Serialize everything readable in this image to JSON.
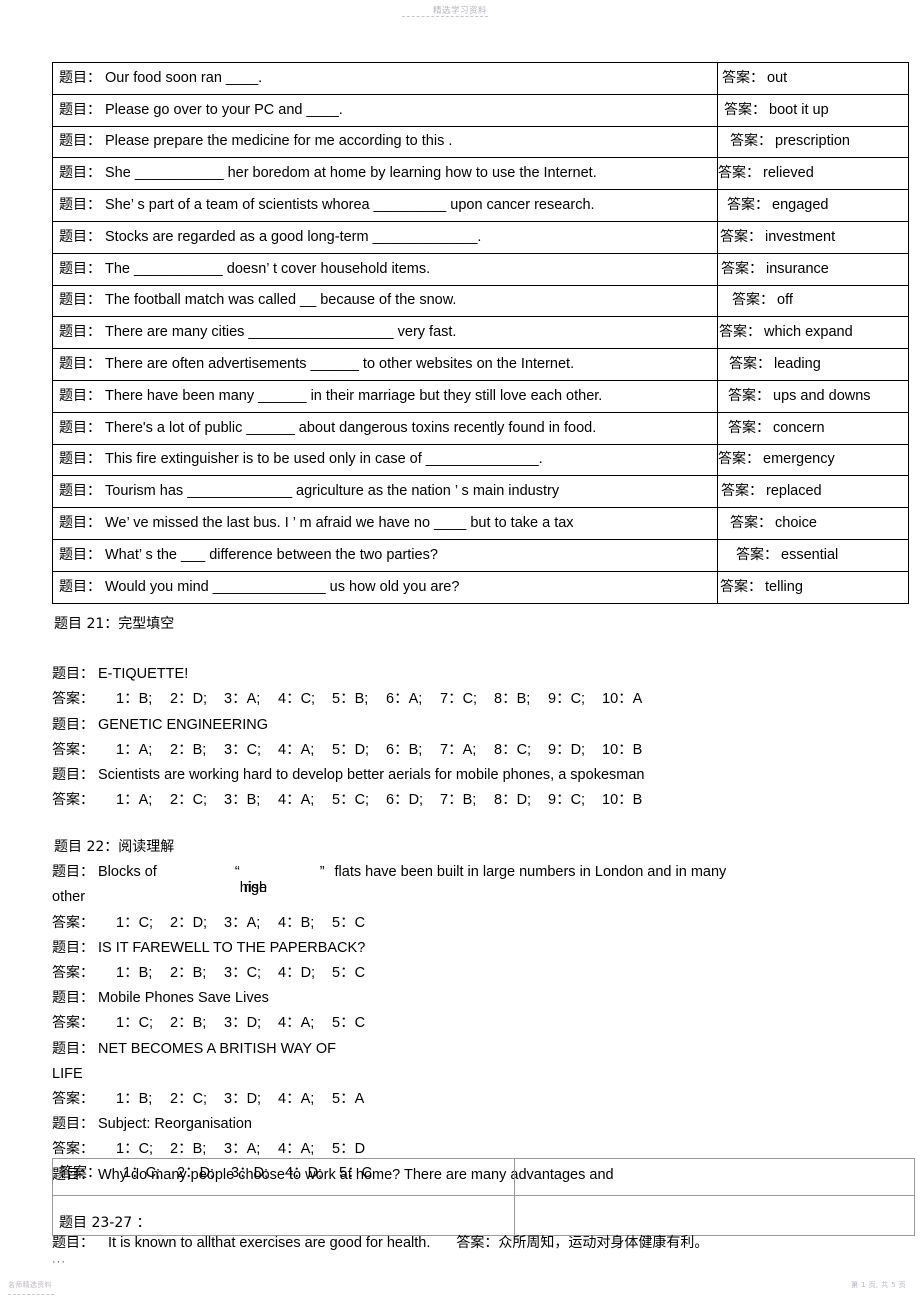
{
  "header": {
    "watermark": "精选学习资料"
  },
  "footer": {
    "left_mark": "名师精选资料",
    "page_number": "第 1 页, 共 5 页"
  },
  "labels": {
    "question": "题目：",
    "answer": "答案：",
    "question_no_colon": "题目"
  },
  "main_table": {
    "rows": [
      {
        "question": "Our food soon ran ____.",
        "answer": "out"
      },
      {
        "question": "Please go over to your PC and ____.",
        "answer": "boot it up"
      },
      {
        "question": "Please prepare the medicine for me according to this              .",
        "answer": "prescription"
      },
      {
        "question": "She ___________ her boredom at home by learning how to use the Internet.",
        "answer": "relieved"
      },
      {
        "question": "She’  s part of a team of scientists whorea _________ upon cancer research.",
        "answer": "engaged"
      },
      {
        "question": "Stocks are regarded as a good long-term _____________.",
        "answer": "investment"
      },
      {
        "question": "The ___________ doesn’  t cover household items.",
        "answer": "insurance"
      },
      {
        "question": "The football match was called __ because of the snow.",
        "answer": "off"
      },
      {
        "question": "There are many cities __________________ very fast.",
        "answer": "which expand"
      },
      {
        "question": "There are often advertisements ______ to other websites on the Internet.",
        "answer": "leading"
      },
      {
        "question": "There have been many ______ in their marriage but they still love each other.",
        "answer": "ups and downs"
      },
      {
        "question": "There's a lot of public ______ about dangerous toxins recently found in food.",
        "answer": "concern"
      },
      {
        "question": "This fire extinguisher is to be used only in case of ______________.",
        "answer": "emergency"
      },
      {
        "question": "Tourism has _____________ agriculture as the nation          ’ s main industry",
        "answer": "replaced"
      },
      {
        "question": "We’  ve missed the last bus. I          ’ m afraid we have no ____ but to take a tax",
        "answer": "choice"
      },
      {
        "question": "What’  s the ___ difference between the two parties?",
        "answer": "essential"
      },
      {
        "question": "Would you mind ______________ us how old you are?",
        "answer": "telling"
      }
    ]
  },
  "section21": {
    "heading": "题目 21：完型填空",
    "entries": [
      {
        "title": "E-TIQUETTE!",
        "answers": [
          "1：B;",
          "2：D;",
          "3：A;",
          "4：C;",
          "5：B;",
          "6：A;",
          "7：C;",
          "8：B;",
          "9：C;",
          "10：A"
        ]
      },
      {
        "title": "GENETIC ENGINEERING",
        "answers": [
          "1：A;",
          "2：B;",
          "3：C;",
          "4：A;",
          "5：D;",
          "6：B;",
          "7：A;",
          "8：C;",
          "9：D;",
          "10：B"
        ]
      },
      {
        "title": "Scientists are working hard to develop better aerials for mobile phones, a spokesman",
        "answers": [
          "1：A;",
          "2：C;",
          "3：B;",
          "4：A;",
          "5：C;",
          "6：D;",
          "7：B;",
          "8：D;",
          "9：C;",
          "10：B"
        ]
      }
    ]
  },
  "section22": {
    "heading": "题目 22：阅读理解",
    "first_entry": {
      "prefix": "Blocks of",
      "quote_open": "“",
      "overlap_a": "high",
      "overlap_b": "rise",
      "quote_close": "”",
      "suffix": "flats have been built in large numbers in London and in many",
      "wrap": "other",
      "answers": [
        "1：C;",
        "2：D;",
        "3：A;",
        "4：B;",
        "5：C"
      ]
    },
    "entries": [
      {
        "title": "IS IT FAREWELL TO THE PAPERBACK?",
        "answers": [
          "1：B;",
          "2：B;",
          "3：C;",
          "4：D;",
          "5：C"
        ]
      },
      {
        "title": "Mobile Phones Save Lives",
        "answers": [
          "1：C;",
          "2：B;",
          "3：D;",
          "4：A;",
          "5：C"
        ]
      },
      {
        "title": "NET BECOMES A BRITISH WAY OF",
        "title_wrap": "LIFE",
        "answers": [
          "1：B;",
          "2：C;",
          "3：D;",
          "4：A;",
          "5：A"
        ]
      },
      {
        "title": "Subject: Reorganisation",
        "answers": [
          "1：C;",
          "2：B;",
          "3：A;",
          "4：A;",
          "5：D"
        ]
      },
      {
        "title": "Why do many people choose to work at home? There are many advantages and",
        "answers": [
          "1：C;",
          "2：D;",
          "3：D;",
          "4：D;",
          "5：C"
        ]
      }
    ]
  },
  "bottom_table": {
    "row1_left_answers": [
      "1：C;",
      "2：D;",
      "3：D;",
      "4：D;",
      "5：C"
    ],
    "row2_left": "题目 23-27 ："
  },
  "tail": {
    "question_text": "It is known to allthat exercises are good for health.",
    "answer_text": "众所周知，运动对身体健康有利。",
    "ellipsis": "···"
  }
}
